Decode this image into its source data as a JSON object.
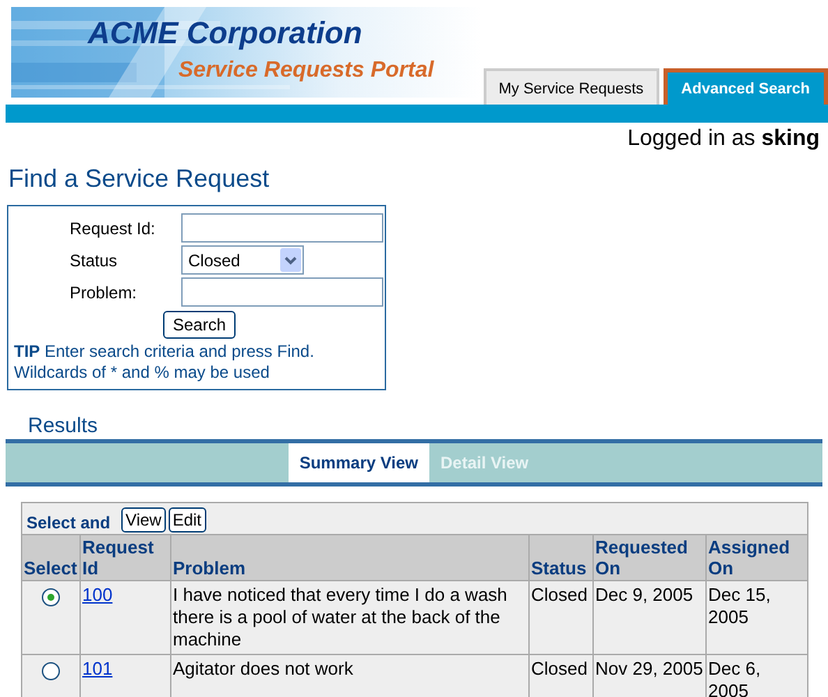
{
  "header": {
    "company": "ACME Corporation",
    "portal": "Service Requests Portal"
  },
  "tabs": [
    {
      "label": "My Service Requests",
      "selected": false
    },
    {
      "label": "Advanced Search",
      "selected": true
    }
  ],
  "login": {
    "prefix": "Logged in as",
    "user": "sking"
  },
  "search": {
    "title": "Find a Service Request",
    "fields": [
      {
        "kind": "text",
        "label": "Request Id:"
      },
      {
        "kind": "select",
        "label": "Status",
        "value": "Closed"
      },
      {
        "kind": "text",
        "label": "Problem:"
      }
    ],
    "button": "Search",
    "tip": [
      "**TIP** Enter search criteria and press Find.",
      "Wildcards of * and % may be used"
    ]
  },
  "results": {
    "title": "Results",
    "views": [
      {
        "label": "Summary View",
        "selected": true
      },
      {
        "label": "Detail View",
        "selected": false
      }
    ],
    "toolbar": {
      "label": "Select and",
      "buttons": [
        "View",
        "Edit"
      ]
    },
    "columns": [
      "Select",
      "Request Id",
      "Problem",
      "Status",
      "Requested On",
      "Assigned On"
    ],
    "rows": [
      {
        "selected": true,
        "id": "100",
        "problem": "I have noticed that every time I do a wash there is a pool of water at the back of the machine",
        "status": "Closed",
        "requested_on": "Dec 9, 2005",
        "assigned_on": "Dec 15, 2005"
      },
      {
        "selected": false,
        "id": "101",
        "problem": "Agitator does not work",
        "status": "Closed",
        "requested_on": "Nov 29, 2005",
        "assigned_on": "Dec 6, 2005"
      }
    ]
  }
}
